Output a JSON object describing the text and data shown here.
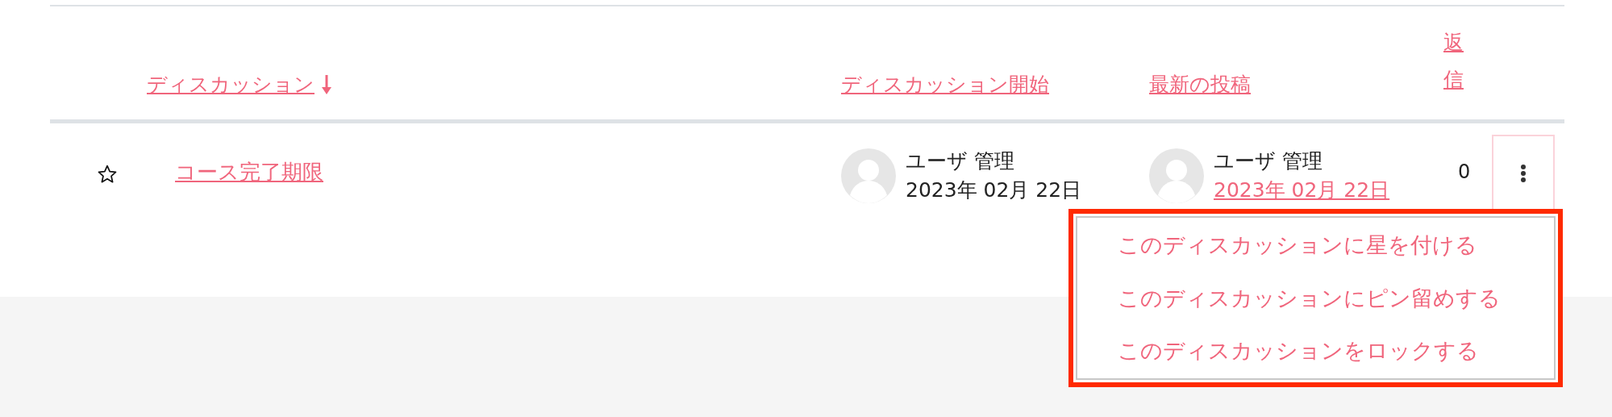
{
  "table": {
    "columns": [
      {
        "label": "ディスカッション",
        "sorted_descending": true
      },
      {
        "label": "ディスカッション開始",
        "sorted_descending": false
      },
      {
        "label": "最新の投稿",
        "sorted_descending": false
      },
      {
        "label": "返信",
        "sorted_descending": false
      }
    ],
    "rows": [
      {
        "starred": false,
        "title": "コース完了期限",
        "started_by": {
          "name": "ユーザ 管理",
          "date": "2023年 02月 22日"
        },
        "last_post": {
          "name": "ユーザ 管理",
          "date": "2023年 02月 22日"
        },
        "replies": "0",
        "menu_expanded": true
      }
    ]
  },
  "actions_menu": {
    "items": [
      {
        "label": "このディスカッションに星を付ける"
      },
      {
        "label": "このディスカッションにピン留めする"
      },
      {
        "label": "このディスカッションをロックする"
      }
    ]
  }
}
